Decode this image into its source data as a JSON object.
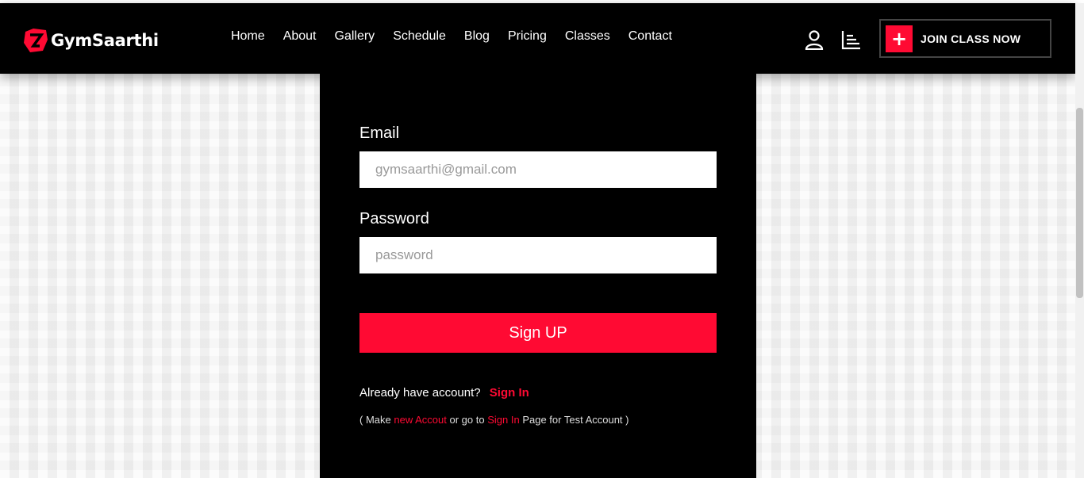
{
  "brand": {
    "name": "GymSaarthi",
    "accent": "#ff0a33"
  },
  "nav": {
    "items": [
      "Home",
      "About",
      "Gallery",
      "Schedule",
      "Blog",
      "Pricing",
      "Classes",
      "Contact"
    ]
  },
  "header": {
    "join_label": "JOIN CLASS NOW",
    "join_icon": "+",
    "user_icon": "user-icon",
    "menu_icon": "bars-icon"
  },
  "form": {
    "email_label": "Email",
    "email_placeholder": "gymsaarthi@gmail.com",
    "password_label": "Password",
    "password_placeholder": "password",
    "submit_label": "Sign UP",
    "already_text": "Already have account?",
    "signin_link": "Sign In",
    "note_prefix": "( Make",
    "note_link1": "new Accout",
    "note_middle": "or go to",
    "note_link2": "Sign In",
    "note_suffix": "Page for Test Account )"
  }
}
